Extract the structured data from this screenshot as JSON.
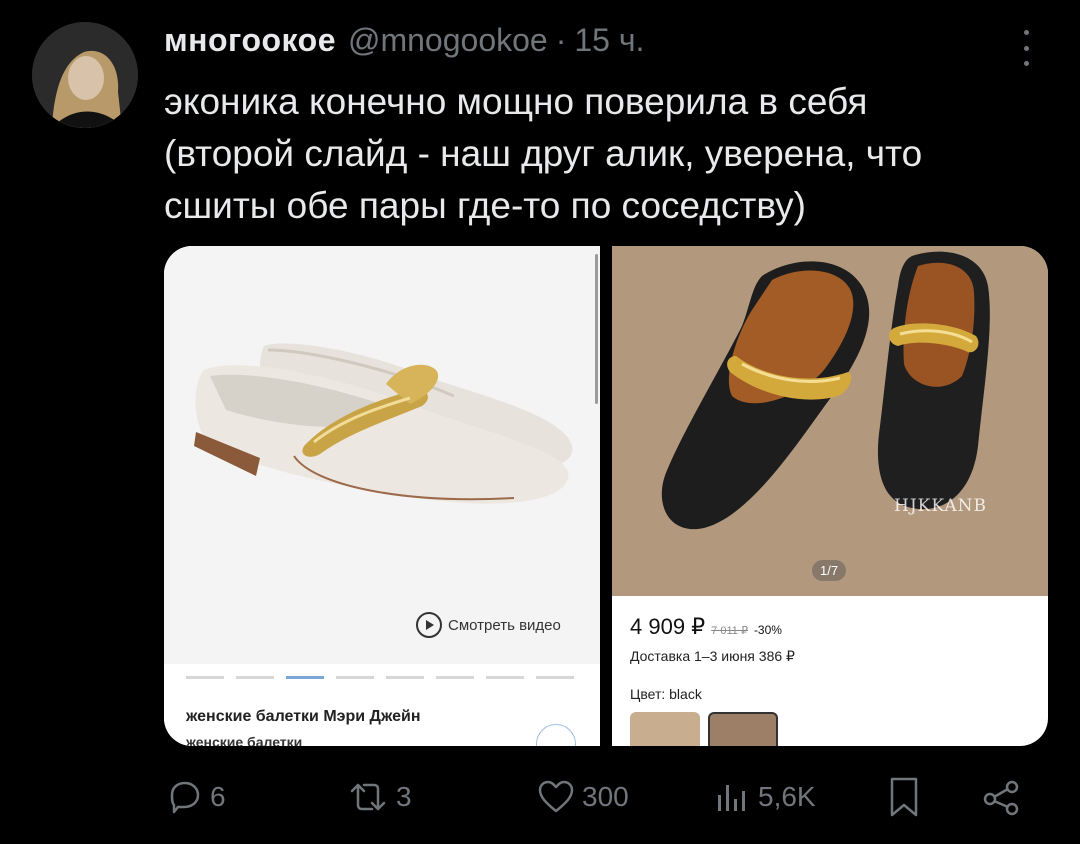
{
  "tweet": {
    "display_name": "многоокое",
    "handle": "@mnogookoe",
    "separator": "·",
    "time": "15 ч.",
    "text_lines": [
      "эконика конечно мощно поверила в себя",
      "(второй слайд - наш друг алик, уверена, что",
      "сшиты обе пары где-то по соседству)"
    ]
  },
  "media": {
    "left_panel": {
      "video_button_label": "Смотреть видео",
      "product_title": "женские балетки Мэри Джейн",
      "product_title_cut": "женские балетки"
    },
    "right_panel": {
      "watermark": "HJKKANB",
      "image_counter": "1/7",
      "price": "4 909 ₽",
      "old_price": "7 011 ₽",
      "discount": "-30%",
      "delivery": "Доставка 1–3 июня 386 ₽",
      "color_label": "Цвет: black"
    }
  },
  "actions": {
    "replies": "6",
    "retweets": "3",
    "likes": "300",
    "views": "5,6K"
  },
  "colors": {
    "background": "#000000",
    "text": "#e7e9ea",
    "muted": "#71767b"
  }
}
